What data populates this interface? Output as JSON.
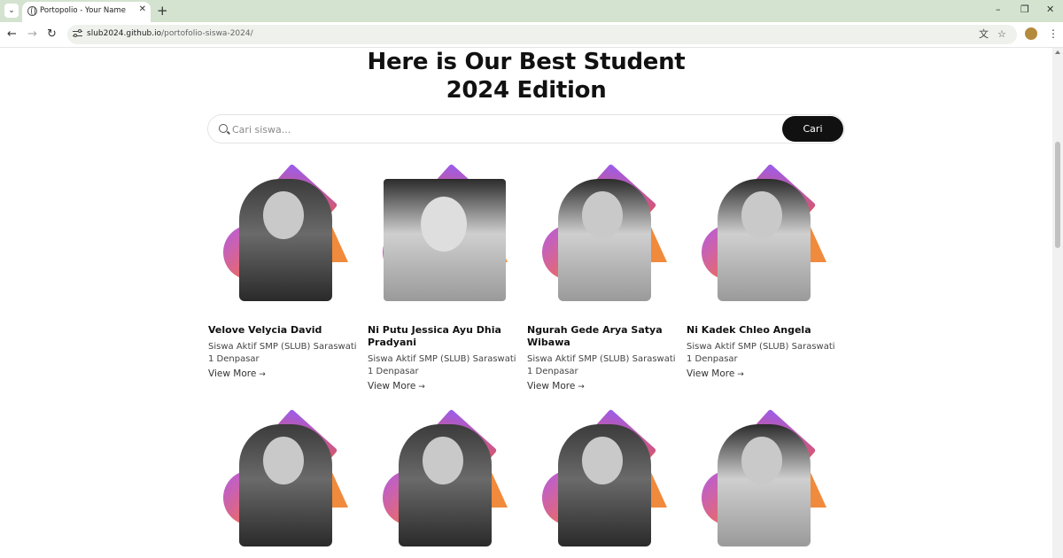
{
  "browser": {
    "tab_title": "Portopolio - Your Name",
    "url_host": "slub2024.github.io",
    "url_path": "/portofolio-siswa-2024/"
  },
  "page": {
    "heading_line1": "Here is Our Best Student",
    "heading_line2": "2024 Edition",
    "search_placeholder": "Cari siswa...",
    "search_button": "Cari"
  },
  "students": [
    {
      "name": "Velove Velycia David",
      "desc": "Siswa Aktif SMP (SLUB) Saraswati 1 Denpasar",
      "link": "View More"
    },
    {
      "name": "Ni Putu Jessica Ayu Dhia Pradyani",
      "desc": "Siswa Aktif SMP (SLUB) Saraswati 1 Denpasar",
      "link": "View More"
    },
    {
      "name": "Ngurah Gede Arya Satya Wibawa",
      "desc": "Siswa Aktif SMP (SLUB) Saraswati 1 Denpasar",
      "link": "View More"
    },
    {
      "name": "Ni Kadek Chleo Angela",
      "desc": "Siswa Aktif SMP (SLUB) Saraswati 1 Denpasar",
      "link": "View More"
    }
  ],
  "icons": {
    "arrow": "→",
    "back": "←",
    "forward": "→",
    "reload": "↻",
    "close": "✕",
    "plus": "+",
    "minimize": "–",
    "restore": "❐",
    "star": "☆",
    "translate": "文",
    "kebab": "⋮",
    "chevron": "⌄"
  }
}
